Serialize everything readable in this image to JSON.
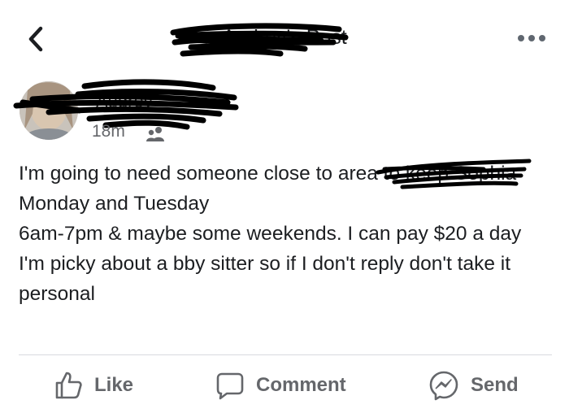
{
  "header": {
    "title": "Audrey's Post",
    "back_icon": "chevron-left-icon",
    "more_icon": "more-horizontal-icon"
  },
  "post": {
    "author": "Audrey",
    "timestamp": "18m",
    "audience_icon": "friends-icon",
    "body": "I'm going to need someone close to  area to keep Sophia Monday and Tuesday\n6am-7pm & maybe some weekends. I can pay $20 a day\nI'm picky about a bby sitter so if I don't reply don't take it personal"
  },
  "actions": {
    "like": "Like",
    "comment": "Comment",
    "send": "Send"
  },
  "colors": {
    "text": "#1c1e21",
    "secondary_text": "#65676b",
    "divider": "#d8dadf",
    "redaction": "#000000"
  }
}
